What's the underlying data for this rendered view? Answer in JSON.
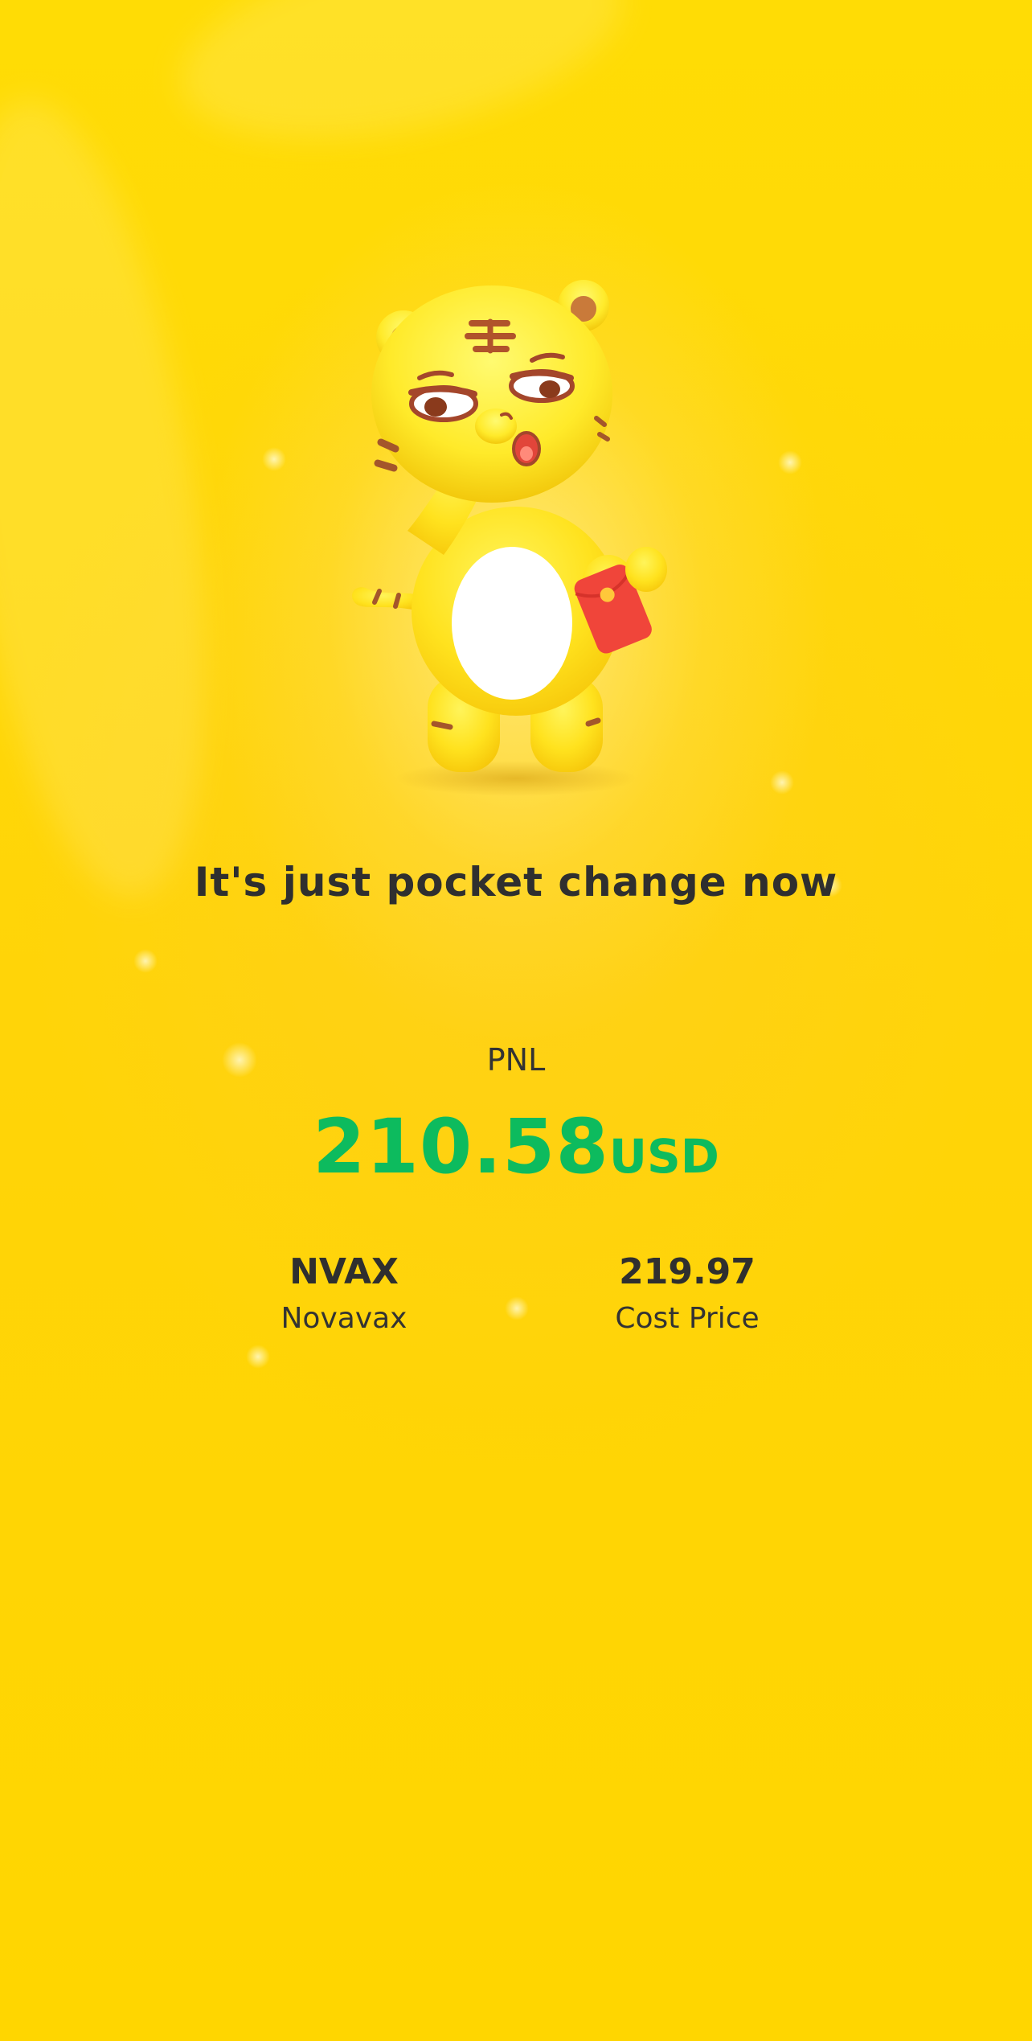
{
  "headline": "It's just pocket change now",
  "pnl": {
    "label": "PNL",
    "value": "210.58",
    "currency": "USD"
  },
  "stats": [
    {
      "main": "NVAX",
      "sub": "Novavax"
    },
    {
      "main": "219.97",
      "sub": "Cost Price"
    }
  ],
  "colors": {
    "background": "#FFD600",
    "profit_green": "#0DBB5E",
    "text_dark": "#2F2F2F"
  },
  "mascot": {
    "icon": "tiger-mascot-holding-red-envelope-icon"
  }
}
